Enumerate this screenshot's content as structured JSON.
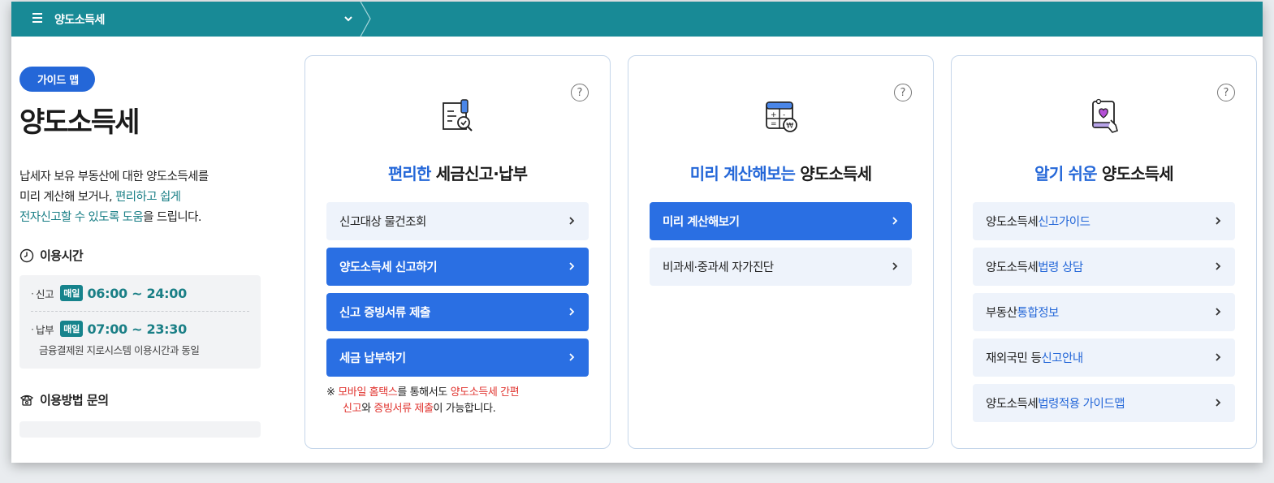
{
  "topbar": {
    "title": "양도소득세"
  },
  "left": {
    "badge": "가이드 맵",
    "title": "양도소득세",
    "desc_line1": "납세자 보유 부동산에 대한 양도소득세를",
    "desc_line2_a": "미리 계산해 보거나, ",
    "desc_line2_b": "편리하고 쉽게",
    "desc_line3_a": "전자신고할 수 있도록 도움",
    "desc_line3_b": "을 드립니다.",
    "hours_title": "이용시간",
    "filing_label": "신고",
    "daily_badge": "매일",
    "filing_hours": "06:00 ~ 24:00",
    "payment_label": "납부",
    "payment_hours": "07:00 ~ 23:30",
    "payment_note": "금융결제원 지로시스템 이용시간과 동일",
    "inquiry_title": "이용방법 문의"
  },
  "cards": [
    {
      "heading_hl": "편리한",
      "heading_rest": " 세금신고·납부",
      "buttons": [
        {
          "label": "신고대상 물건조회"
        },
        {
          "label": "양도소득세 신고하기"
        },
        {
          "label": "신고 증빙서류 제출"
        },
        {
          "label": "세금 납부하기"
        }
      ],
      "warn": {
        "mark": "※ ",
        "red1": "모바일 홈택스",
        "t1": "를 통해서도 ",
        "red2": "양도소득세 간편",
        "red3": "신고",
        "t2": "와 ",
        "red4": "증빙서류 제출",
        "t3": "이 가능합니다."
      }
    },
    {
      "heading_hl": "미리 계산해보는",
      "heading_rest": " 양도소득세",
      "buttons": [
        {
          "label": "미리 계산해보기"
        },
        {
          "label": "비과세·중과세 자가진단"
        }
      ]
    },
    {
      "heading_hl": "알기 쉬운",
      "heading_rest": " 양도소득세",
      "buttons": [
        {
          "pre": "양도소득세 ",
          "hl": "신고가이드"
        },
        {
          "pre": "양도소득세 ",
          "hl": "법령 상담"
        },
        {
          "pre": "부동산 ",
          "hl": "통합정보"
        },
        {
          "pre": "재외국민 등 ",
          "hl": "신고안내"
        },
        {
          "pre": "양도소득세 ",
          "hl": "법령적용 가이드맵"
        }
      ]
    }
  ],
  "help_mark": "?",
  "colors": {
    "topbar": "#188a96",
    "primary": "#2a6fe3",
    "teal": "#1a7f86",
    "red": "#e0332e"
  }
}
